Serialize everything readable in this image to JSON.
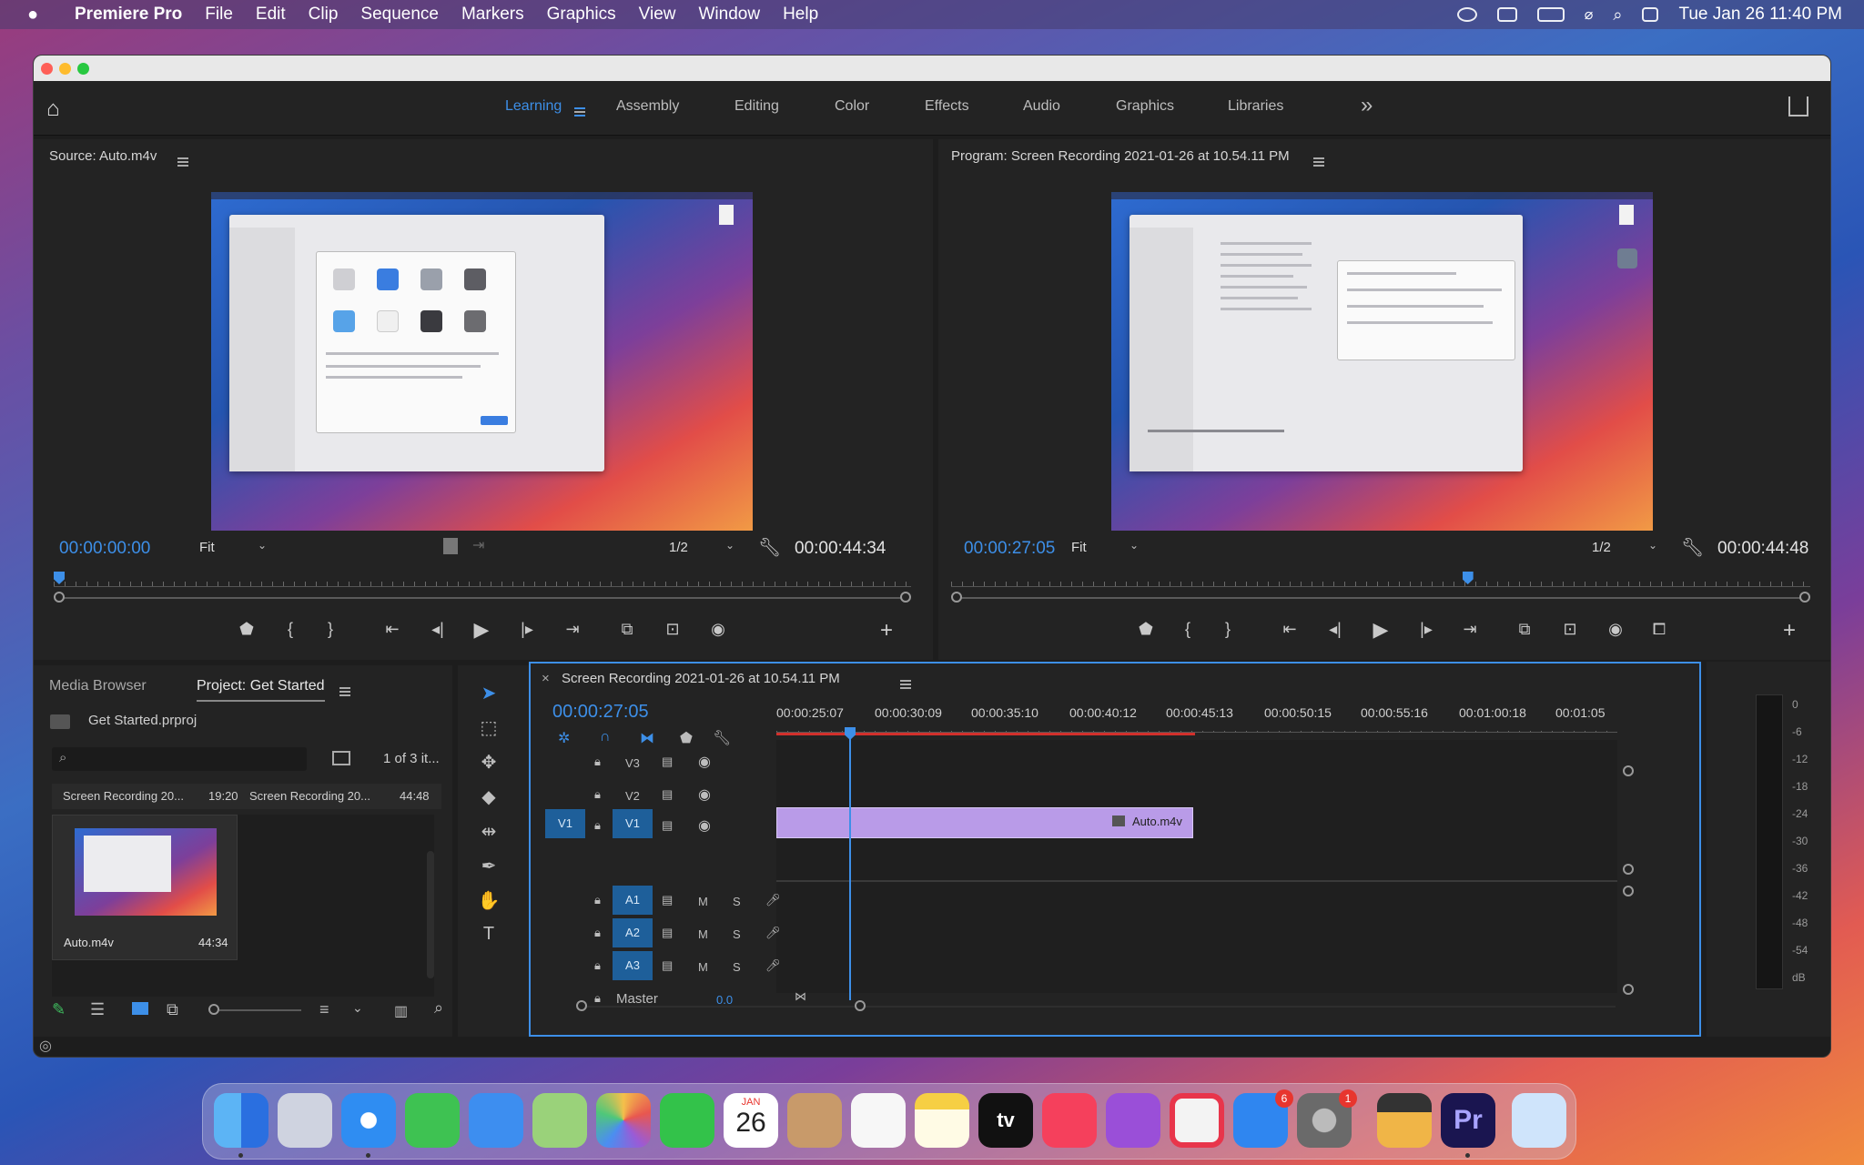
{
  "menubar": {
    "app_name": "Premiere Pro",
    "items": [
      "File",
      "Edit",
      "Clip",
      "Sequence",
      "Markers",
      "Graphics",
      "View",
      "Window",
      "Help"
    ],
    "datetime": "Tue Jan 26  11:40 PM"
  },
  "workspaces": {
    "tabs": [
      "Learning",
      "Assembly",
      "Editing",
      "Color",
      "Effects",
      "Audio",
      "Graphics",
      "Libraries"
    ],
    "active": "Learning",
    "more": "»"
  },
  "source_monitor": {
    "title": "Source: Auto.m4v",
    "timecode": "00:00:00:00",
    "fit": "Fit",
    "resolution": "1/2",
    "duration": "00:00:44:34",
    "playhead_fraction": 0.0
  },
  "program_monitor": {
    "title": "Program: Screen Recording 2021-01-26 at 10.54.11 PM",
    "timecode": "00:00:27:05",
    "fit": "Fit",
    "resolution": "1/2",
    "duration": "00:00:44:48",
    "playhead_fraction": 0.595
  },
  "project_panel": {
    "tab_media_browser": "Media Browser",
    "tab_project": "Project: Get Started",
    "project_file": "Get Started.prproj",
    "item_count": "1 of 3 it...",
    "headers": [
      {
        "name": "Screen Recording 20...",
        "duration": "19:20"
      },
      {
        "name": "Screen Recording 20...",
        "duration": "44:48"
      }
    ],
    "clip": {
      "name": "Auto.m4v",
      "duration": "44:34"
    }
  },
  "timeline": {
    "close": "×",
    "title": "Screen Recording 2021-01-26 at 10.54.11 PM",
    "timecode": "00:00:27:05",
    "ruler_labels": [
      "00:00:25:07",
      "00:00:30:09",
      "00:00:35:10",
      "00:00:40:12",
      "00:00:45:13",
      "00:00:50:15",
      "00:00:55:16",
      "00:01:00:18",
      "00:01:05"
    ],
    "video_tracks": [
      "V3",
      "V2",
      "V1"
    ],
    "source_patch": "V1",
    "audio_tracks": [
      "A1",
      "A2",
      "A3"
    ],
    "mute": "M",
    "solo": "S",
    "master_label": "Master",
    "master_value": "0.0",
    "clip_label": "Auto.m4v"
  },
  "audio_meter": {
    "labels": [
      "0",
      "-6",
      "-12",
      "-18",
      "-24",
      "-30",
      "-36",
      "-42",
      "-48",
      "-54",
      "dB"
    ]
  },
  "dock": {
    "calendar_month": "JAN",
    "calendar_day": "26",
    "appstore_badge": "6",
    "settings_badge": "1",
    "tv_label": "tv",
    "premiere_label": "Pr"
  },
  "colors": {
    "accent": "#3d8fe8",
    "clip": "#b99be8",
    "inout_bar": "#d2302c"
  }
}
